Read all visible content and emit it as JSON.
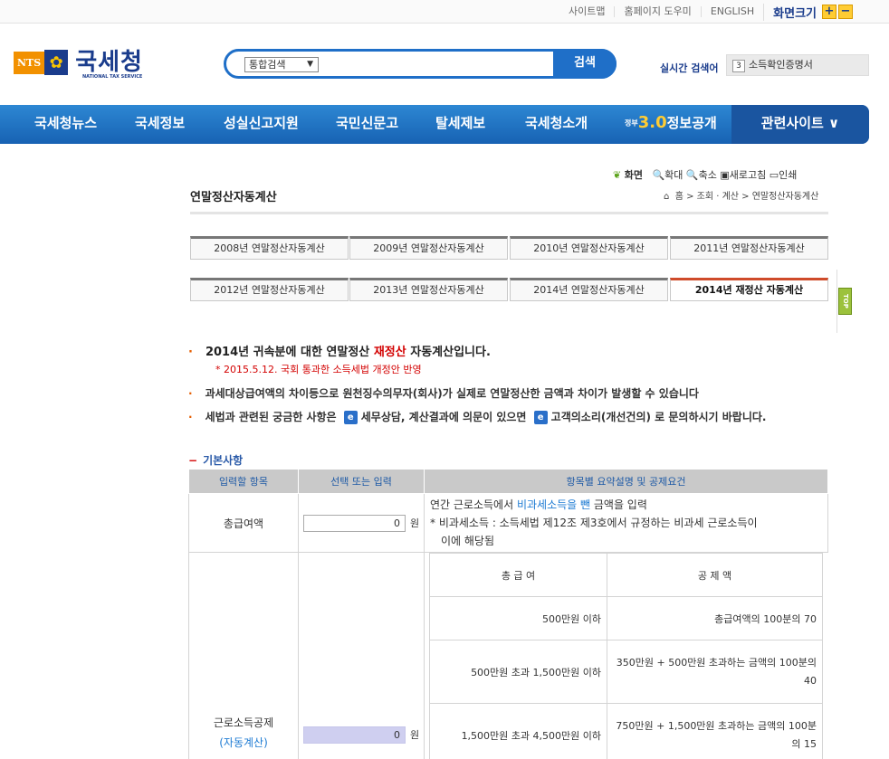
{
  "utility": {
    "links": [
      "사이트맵",
      "홈페이지 도우미",
      "ENGLISH"
    ],
    "font_size_label": "화면크기",
    "plus": "+",
    "minus": "−"
  },
  "logo": {
    "nts": "NTS",
    "name": "국세청",
    "english": "NATIONAL TAX SERVICE"
  },
  "search": {
    "category": "통합검색",
    "button": "검색",
    "realtime_label": "실시간 검색어",
    "realtime_rank": "3",
    "realtime_term": "소득확인증명서"
  },
  "gnb": {
    "items": [
      "국세청뉴스",
      "국세정보",
      "성실신고지원",
      "국민신문고",
      "탈세제보",
      "국세청소개"
    ],
    "gov_prefix": "정부",
    "info_label": "정보공개",
    "related": "관련사이트 ∨"
  },
  "page": {
    "tools": [
      "화면",
      "확대",
      "축소",
      "새로고침",
      "인쇄"
    ],
    "title": "연말정산자동계산",
    "breadcrumb": "홈 > 조회 · 계산 > 연말정산자동계산",
    "top": "TOP"
  },
  "tabs": [
    "2008년 연말정산자동계산",
    "2009년 연말정산자동계산",
    "2010년 연말정산자동계산",
    "2011년 연말정산자동계산",
    "2012년 연말정산자동계산",
    "2013년 연말정산자동계산",
    "2014년 연말정산자동계산",
    "2014년 재정산 자동계산"
  ],
  "notes": {
    "line1_a": "2014년 귀속분에 대한 연말정산 ",
    "line1_red": "재정산",
    "line1_b": " 자동계산입니다.",
    "line1_sub": "* 2015.5.12. 국회 통과한 소득세법 개정안 반영",
    "line2": "과세대상급여액의 차이등으로 원천징수의무자(회사)가 실제로 연말정산한 금액과 차이가 발생할 수 있습니다",
    "line3_a": "세법과 관련된 궁금한 사항은",
    "line3_b": "세무상담, 계산결과에 의문이 있으면",
    "line3_c": "고객의소리(개선건의) 로 문의하시기 바랍니다."
  },
  "section": {
    "title": "기본사항",
    "headers": [
      "입력할 항목",
      "선택 또는 입력",
      "항목별 요약설명 및 공제요건"
    ]
  },
  "rows": {
    "gross": {
      "label": "총급여액",
      "value": "0",
      "unit": "원",
      "desc1_a": "연간 근로소득에서 ",
      "desc1_link": "비과세소득을 뺀",
      "desc1_b": " 금액을 입력",
      "desc2": "* 비과세소득 : 소득세법 제12조 제3호에서 규정하는 비과세 근로소득이",
      "desc3": "이에 해당됨"
    },
    "deduction": {
      "label": "근로소득공제",
      "auto": "(자동계산)",
      "value": "0",
      "unit": "원",
      "inner_headers": [
        "총 급 여",
        "공 제 액"
      ],
      "inner_rows": [
        [
          "500만원 이하",
          "총급여액의 100분의 70"
        ],
        [
          "500만원 초과 1,500만원 이하",
          "350만원 + 500만원 초과하는 금액의 100분의 40"
        ],
        [
          "1,500만원 초과 4,500만원 이하",
          "750만원 + 1,500만원 초과하는 금액의 100분의 15"
        ]
      ]
    }
  }
}
